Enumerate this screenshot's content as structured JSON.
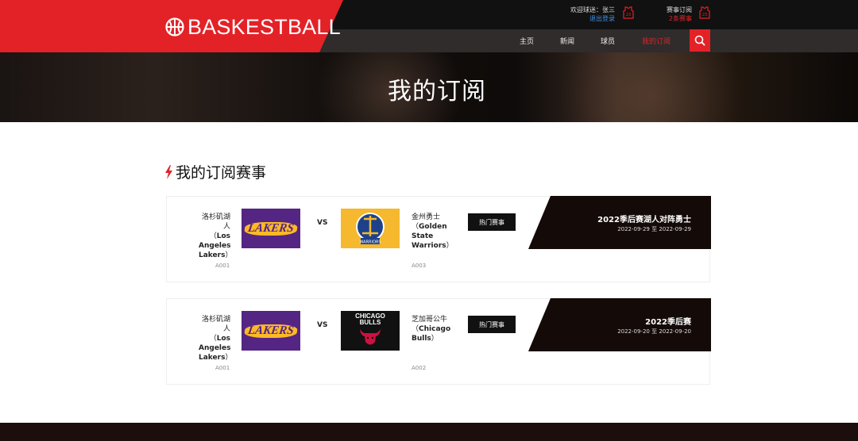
{
  "header": {
    "logo_text": "BASKESTBALL",
    "welcome_label": "欢迎球迷：张三",
    "logout_label": "退出登录",
    "subscribe_label": "赛事订阅",
    "subscribe_count": "2条赛事"
  },
  "nav": {
    "items": [
      {
        "label": "主页"
      },
      {
        "label": "新闻"
      },
      {
        "label": "球员"
      },
      {
        "label": "我的订阅",
        "active": true
      }
    ]
  },
  "hero": {
    "title": "我的订阅"
  },
  "section": {
    "title": "我的订阅赛事"
  },
  "subscriptions": [
    {
      "home": {
        "name_cn": "洛杉矶湖人",
        "name_en": "Los Angeles Lakers",
        "code": "A001",
        "logo_text": "LAKERS"
      },
      "vs": "VS",
      "away": {
        "name_cn": "金州勇士",
        "name_en": "Golden State Warriors",
        "code": "A003",
        "logo_text": "WARRIORS"
      },
      "hot_label": "热门赛事",
      "event_title": "2022季后赛湖人对阵勇士",
      "event_date": "2022-09-29 至 2022-09-29"
    },
    {
      "home": {
        "name_cn": "洛杉矶湖人",
        "name_en": "Los Angeles Lakers",
        "code": "A001",
        "logo_text": "LAKERS"
      },
      "vs": "VS",
      "away": {
        "name_cn": "芝加哥公牛",
        "name_en": "Chicago Bulls",
        "code": "A002",
        "logo_text": "CHICAGO BULLS"
      },
      "hot_label": "热门赛事",
      "event_title": "2022季后赛",
      "event_date": "2022-09-20 至 2022-09-20"
    }
  ],
  "colors": {
    "accent": "#e32227",
    "dark": "#111111",
    "link": "#3b8fe6"
  }
}
